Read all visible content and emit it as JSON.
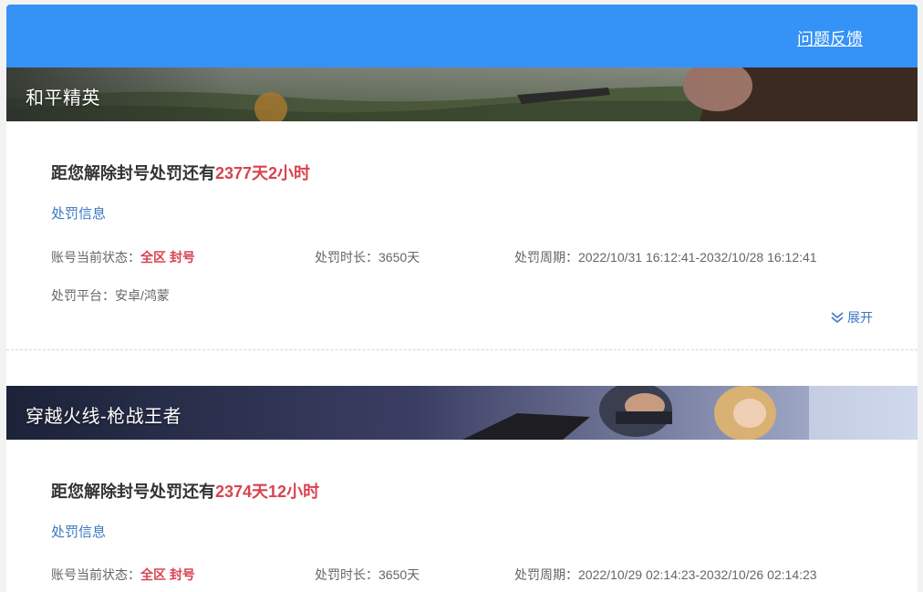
{
  "header": {
    "feedback_label": "问题反馈"
  },
  "bans": [
    {
      "game": "和平精英",
      "countdown_prefix": "距您解除封号处罚还有",
      "countdown_value": "2377天2小时",
      "info_title": "处罚信息",
      "status_label": "账号当前状态：",
      "status_value": "全区 封号",
      "duration_label": "处罚时长：",
      "duration_value": "3650天",
      "period_label": "处罚周期：",
      "period_value": "2022/10/31 16:12:41-2032/10/28 16:12:41",
      "platform_label": "处罚平台：",
      "platform_value": "安卓/鸿蒙",
      "expand_label": "展开"
    },
    {
      "game": "穿越火线-枪战王者",
      "countdown_prefix": "距您解除封号处罚还有",
      "countdown_value": "2374天12小时",
      "info_title": "处罚信息",
      "status_label": "账号当前状态：",
      "status_value": "全区 封号",
      "duration_label": "处罚时长：",
      "duration_value": "3650天",
      "period_label": "处罚周期：",
      "period_value": "2022/10/29 02:14:23-2032/10/26 02:14:23"
    }
  ],
  "colors": {
    "header_blue": "#3592f7",
    "highlight_red": "#d9434f",
    "link_blue": "#3b78c2"
  }
}
